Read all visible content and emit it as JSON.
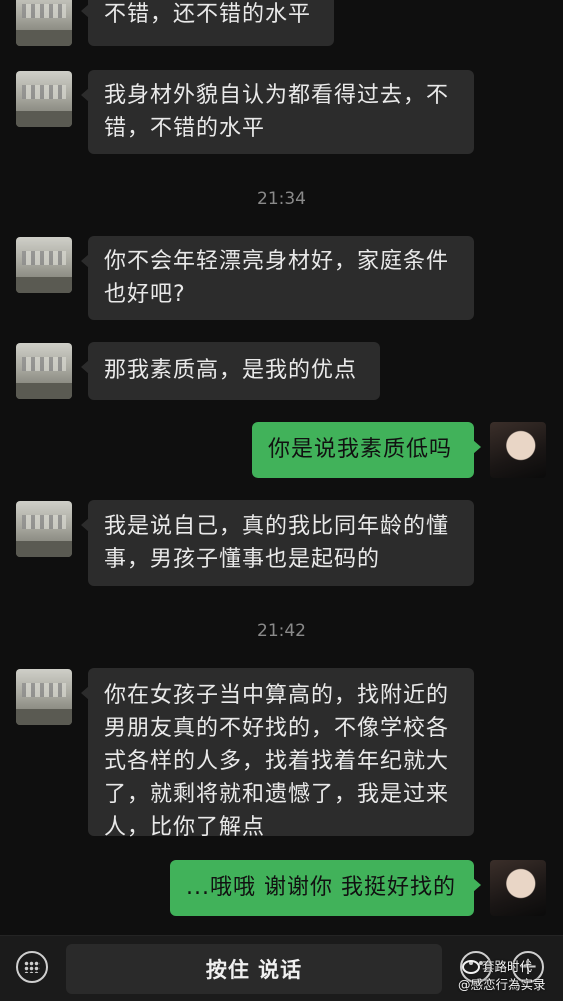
{
  "messages": [
    {
      "side": "in",
      "text_lines": [
        "不错，还不错的水平"
      ]
    },
    {
      "side": "in",
      "text_lines": [
        "我身材外貌自认为都看得过去，不",
        "错，不错的水平"
      ]
    },
    {
      "timestamp": "21:34"
    },
    {
      "side": "in",
      "text_lines": [
        "你不会年轻漂亮身材好，家庭条件",
        "也好吧?"
      ]
    },
    {
      "side": "in",
      "text_lines": [
        "那我素质高，是我的优点"
      ]
    },
    {
      "side": "out",
      "text_lines": [
        "你是说我素质低吗"
      ]
    },
    {
      "side": "in",
      "text_lines": [
        "我是说自己，真的我比同年龄的懂",
        "事，男孩子懂事也是起码的"
      ]
    },
    {
      "timestamp": "21:42"
    },
    {
      "side": "in",
      "text_lines": [
        "你在女孩子当中算高的，找附近的",
        "男朋友真的不好找的，不像学校各",
        "式各样的人多，找着找着年纪就大",
        "了，就剩将就和遗憾了，我是过来",
        "人，比你了解点"
      ]
    },
    {
      "side": "out",
      "text_lines": [
        "...哦哦 谢谢你 我挺好找的"
      ]
    }
  ],
  "input_bar": {
    "hold_to_talk_label": "按住 说话",
    "icons": [
      "keyboard-icon",
      "emoji-icon",
      "plus-icon"
    ]
  },
  "watermark": {
    "line1": "套路时代",
    "line2": "@感恋行為实录"
  },
  "colors": {
    "background": "#0f0f0f",
    "incoming_bubble": "#2c2c2c",
    "outgoing_bubble": "#41b25a",
    "timestamp_text": "#8a8a8a"
  }
}
